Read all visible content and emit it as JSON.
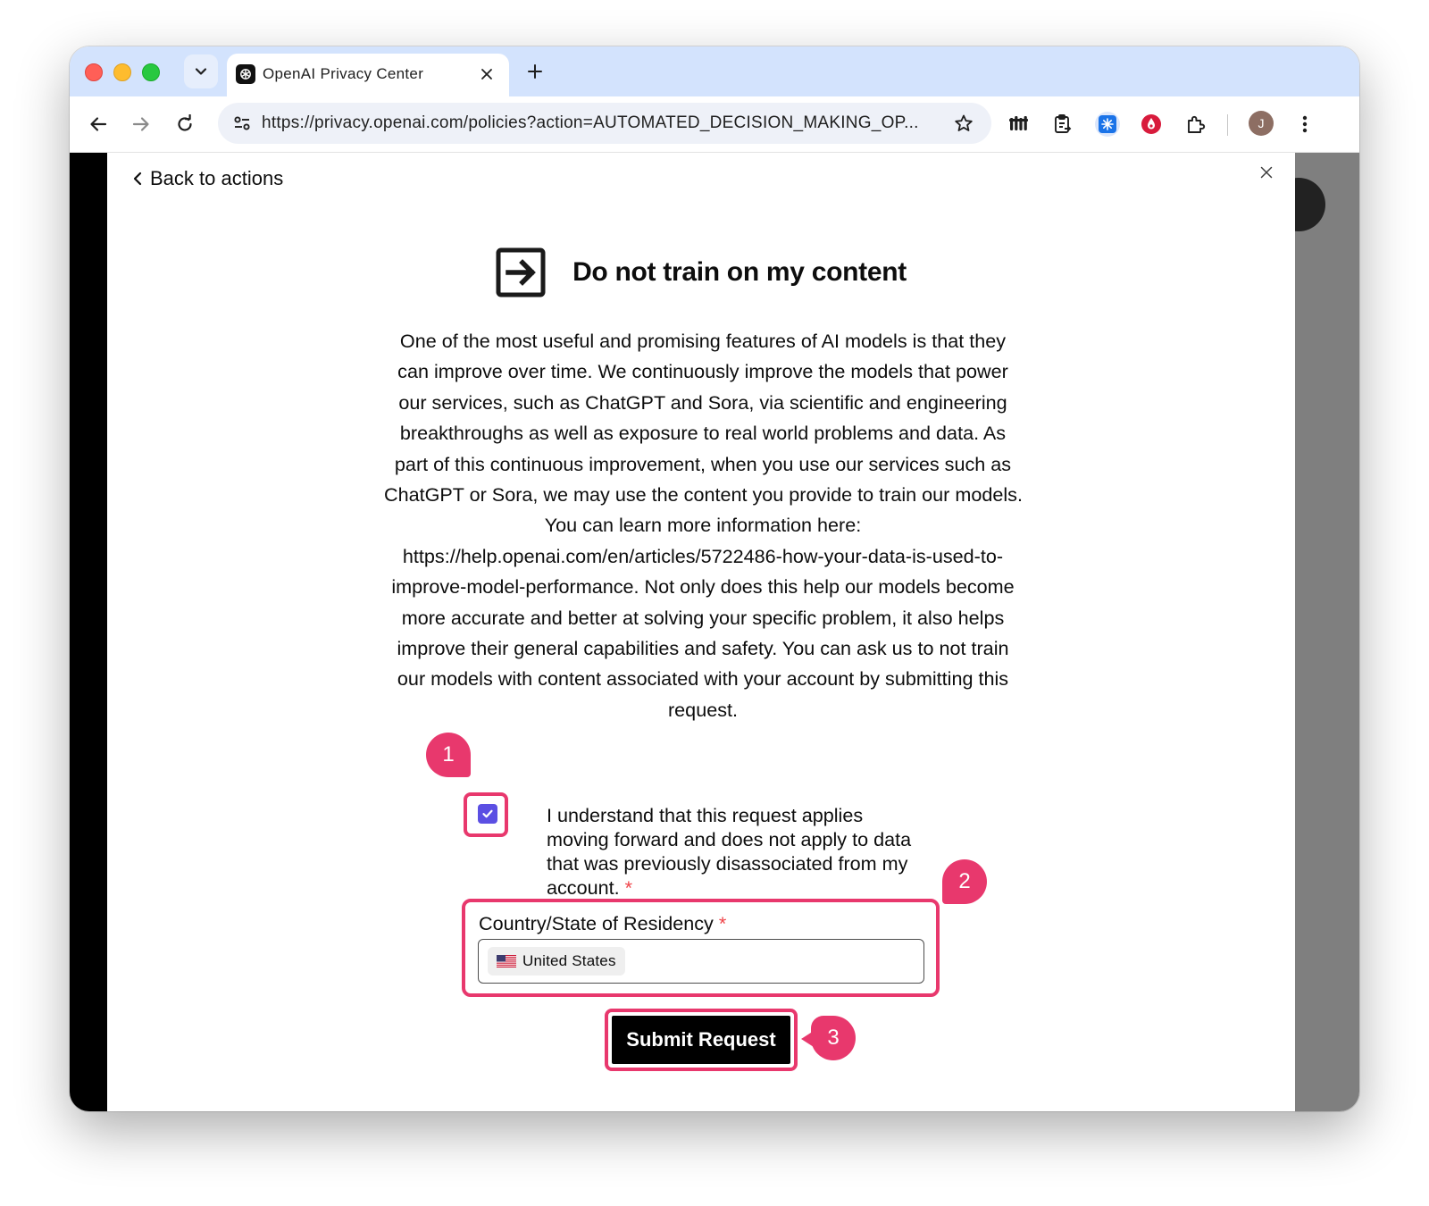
{
  "browser": {
    "tab_title": "OpenAI Privacy Center",
    "url": "https://privacy.openai.com/policies?action=AUTOMATED_DECISION_MAKING_OP...",
    "profile_initial": "J"
  },
  "modal": {
    "back_label": "Back to actions",
    "title": "Do not train on my content",
    "description_lines": [
      "One of the most useful and promising features of AI models is that they",
      "can improve over time. We continuously improve the models that power",
      "our services, such as ChatGPT and Sora, via scientific and engineering",
      "breakthroughs as well as exposure to real world problems and data. As",
      "part of this continuous improvement, when you use our services such as",
      "ChatGPT or Sora, we may use the content you provide to train our models.",
      "You can learn more information here:",
      "https://help.openai.com/en/articles/5722486-how-your-data-is-used-to-",
      "improve-model-performance. Not only does this help our models become",
      "more accurate and better at solving your specific problem, it also helps",
      "improve their general capabilities and safety. You can ask us to not train",
      "our models with content associated with your account by submitting this",
      "request."
    ],
    "consent_lines": [
      "I understand that this request applies",
      "moving forward and does not apply to data",
      "that was previously disassociated from my",
      "account."
    ],
    "consent_checked": true,
    "required_mark": "*",
    "country_label": "Country/State of Residency",
    "country_value": "United States",
    "submit_label": "Submit Request"
  },
  "annotations": {
    "step1": "1",
    "step2": "2",
    "step3": "3",
    "color": "#e8386d"
  },
  "icons": [
    "dropdown-chevron-icon",
    "openai-logo-icon",
    "close-icon",
    "plus-icon",
    "back-arrow-icon",
    "forward-arrow-icon",
    "reload-icon",
    "site-settings-icon",
    "star-icon",
    "extension-icon",
    "kebab-menu-icon",
    "exit-arrow-icon",
    "us-flag-icon",
    "check-icon"
  ]
}
